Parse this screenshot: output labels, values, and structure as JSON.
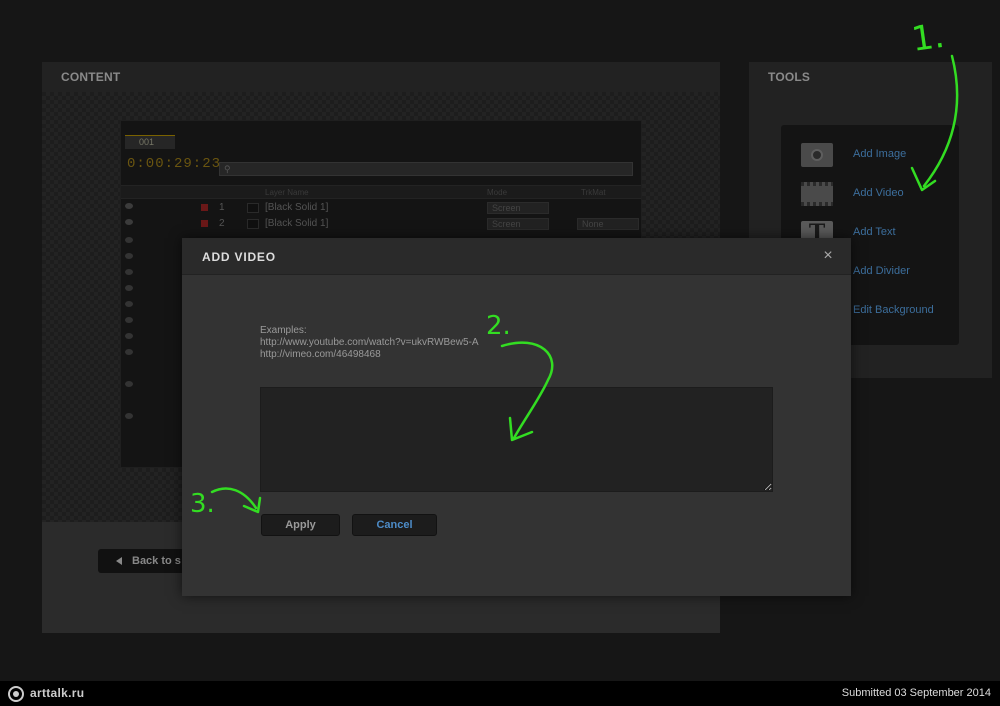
{
  "content_panel": {
    "title": "CONTENT",
    "ae": {
      "comp_tab": "001",
      "timecode": "0:00:29:23",
      "columns": {
        "layer_name": "Layer Name",
        "mode": "Mode",
        "trkmat": "TrkMat"
      },
      "rows": [
        {
          "num": "1",
          "name": "[Black Solid 1]",
          "mode": "Screen",
          "trkmat": ""
        },
        {
          "num": "2",
          "name": "[Black Solid 1]",
          "mode": "Screen",
          "trkmat": "None"
        }
      ]
    },
    "back_button": "Back to s"
  },
  "tools_panel": {
    "title": "TOOLS",
    "items": [
      {
        "label": "Add Image",
        "icon": "camera-icon"
      },
      {
        "label": "Add Video",
        "icon": "film-icon"
      },
      {
        "label": "Add Text",
        "icon": "text-icon"
      },
      {
        "label": "Add Divider",
        "icon": "divider-icon"
      },
      {
        "label": "Edit Background",
        "icon": "background-icon"
      }
    ]
  },
  "modal": {
    "title": "ADD VIDEO",
    "close_icon": "×",
    "examples_label": "Examples:",
    "example_1": "http://www.youtube.com/watch?v=ukvRWBew5-A",
    "example_2": "http://vimeo.com/46498468",
    "input_value": "",
    "apply_label": "Apply",
    "cancel_label": "Cancel"
  },
  "annotations": {
    "step_1": "1.",
    "step_2": "2.",
    "step_3": "3.",
    "color": "#33dd22"
  },
  "footer": {
    "logo_text": "arttalk.ru",
    "submitted": "Submitted 03 September 2014"
  }
}
